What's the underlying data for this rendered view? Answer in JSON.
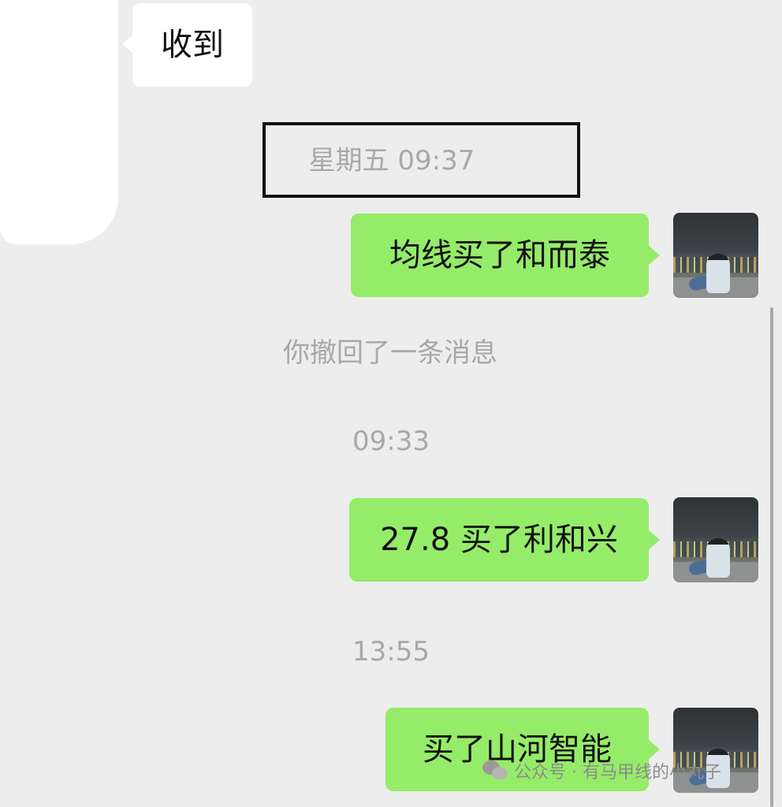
{
  "messages": {
    "received": {
      "text": "收到"
    },
    "timestamp_1": "星期五 09:37",
    "sent_1": "均线买了和而泰",
    "recall_notice": "你撤回了一条消息",
    "timestamp_2": "09:33",
    "sent_2": "27.8 买了利和兴",
    "timestamp_3": "13:55",
    "sent_3": "买了山河智能"
  },
  "watermark": {
    "text": "公众号 · 有马甲线的小丸子",
    "icon": "wechat-icon"
  },
  "colors": {
    "background": "#ededed",
    "sent_bubble": "#95ec69",
    "received_bubble": "#ffffff",
    "timestamp": "#a8a8a8",
    "highlight_border": "#111111"
  }
}
